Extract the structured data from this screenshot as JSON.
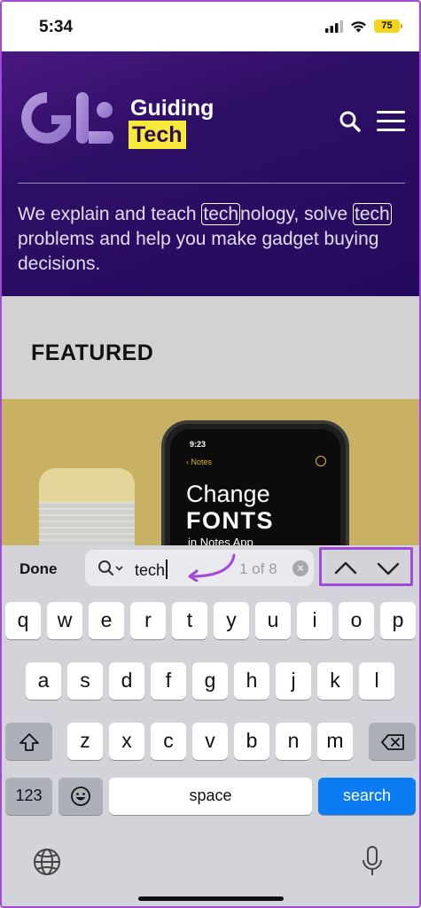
{
  "status": {
    "time": "5:34",
    "battery": "75"
  },
  "site": {
    "brand_line1": "Guiding",
    "brand_line2": "Tech",
    "tagline_parts": [
      "We explain and teach ",
      "tech",
      "nology, solve ",
      "tech",
      " problems and help you make gadget buying decisions."
    ]
  },
  "featured": {
    "heading": "FEATURED",
    "image": {
      "time": "9:23",
      "back_label": "Notes",
      "line1": "Change",
      "line2": "FONTS",
      "line3": "in Notes App"
    }
  },
  "find_bar": {
    "done_label": "Done",
    "query": "tech",
    "match_count": "1 of 8",
    "clear_symbol": "×"
  },
  "keyboard": {
    "row1": [
      "q",
      "w",
      "e",
      "r",
      "t",
      "y",
      "u",
      "i",
      "o",
      "p"
    ],
    "row2": [
      "a",
      "s",
      "d",
      "f",
      "g",
      "h",
      "j",
      "k",
      "l"
    ],
    "row3": [
      "z",
      "x",
      "c",
      "v",
      "b",
      "n",
      "m"
    ],
    "numbers_label": "123",
    "space_label": "space",
    "search_label": "search"
  },
  "colors": {
    "header_purple": "#2e0f67",
    "highlight_yellow": "#f7ea3a",
    "accent_purple": "#a24ad8",
    "key_blue": "#0c7cf5"
  }
}
